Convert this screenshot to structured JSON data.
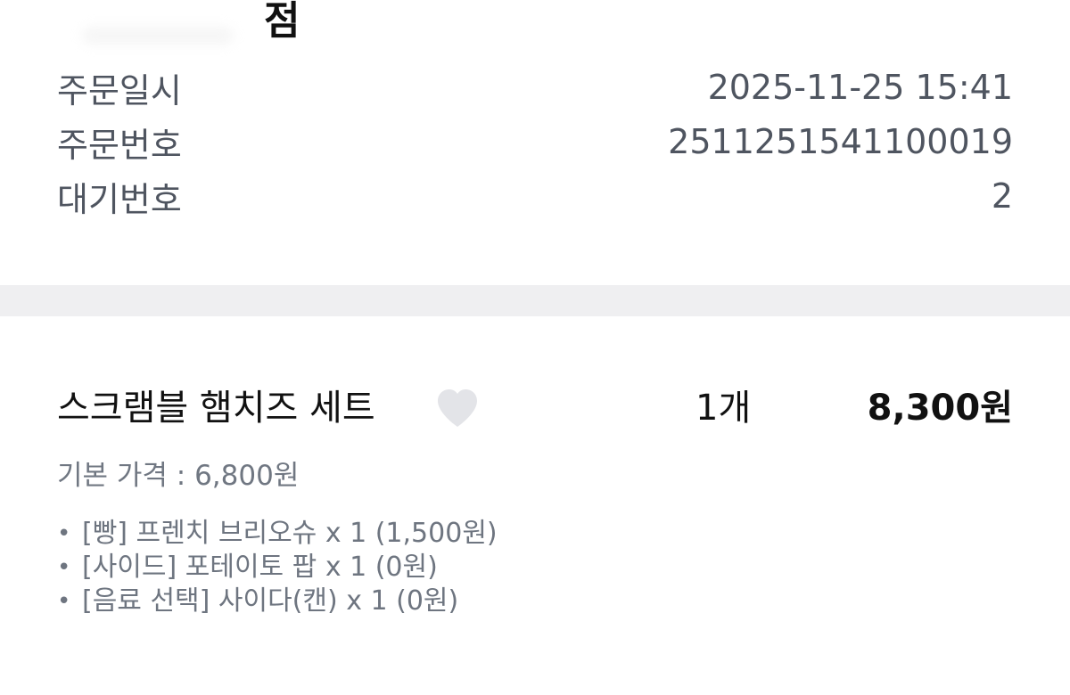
{
  "store": {
    "name_suffix": "점"
  },
  "order_info": [
    {
      "label": "주문일시",
      "value": "2025-11-25 15:41"
    },
    {
      "label": "주문번호",
      "value": "2511251541100019"
    },
    {
      "label": "대기번호",
      "value": "2"
    }
  ],
  "item": {
    "name": "스크램블 햄치즈 세트",
    "favorite_icon": "heart-icon",
    "quantity": "1개",
    "price": "8,300원",
    "base_price": "기본 가격 : 6,800원",
    "options": [
      {
        "bullet": "•",
        "text": "[빵] 프렌치 브리오슈 x 1 (1,500원)"
      },
      {
        "bullet": "•",
        "text": "[사이드] 포테이토 팝 x 1 (0원)"
      },
      {
        "bullet": "•",
        "text": "[음료 선택] 사이다(캔) x 1 (0원)"
      }
    ]
  },
  "colors": {
    "divider": "#efeff1",
    "label_gray": "#4f5560",
    "option_gray": "#6e7580",
    "heart_gray": "#e3e4e8"
  }
}
